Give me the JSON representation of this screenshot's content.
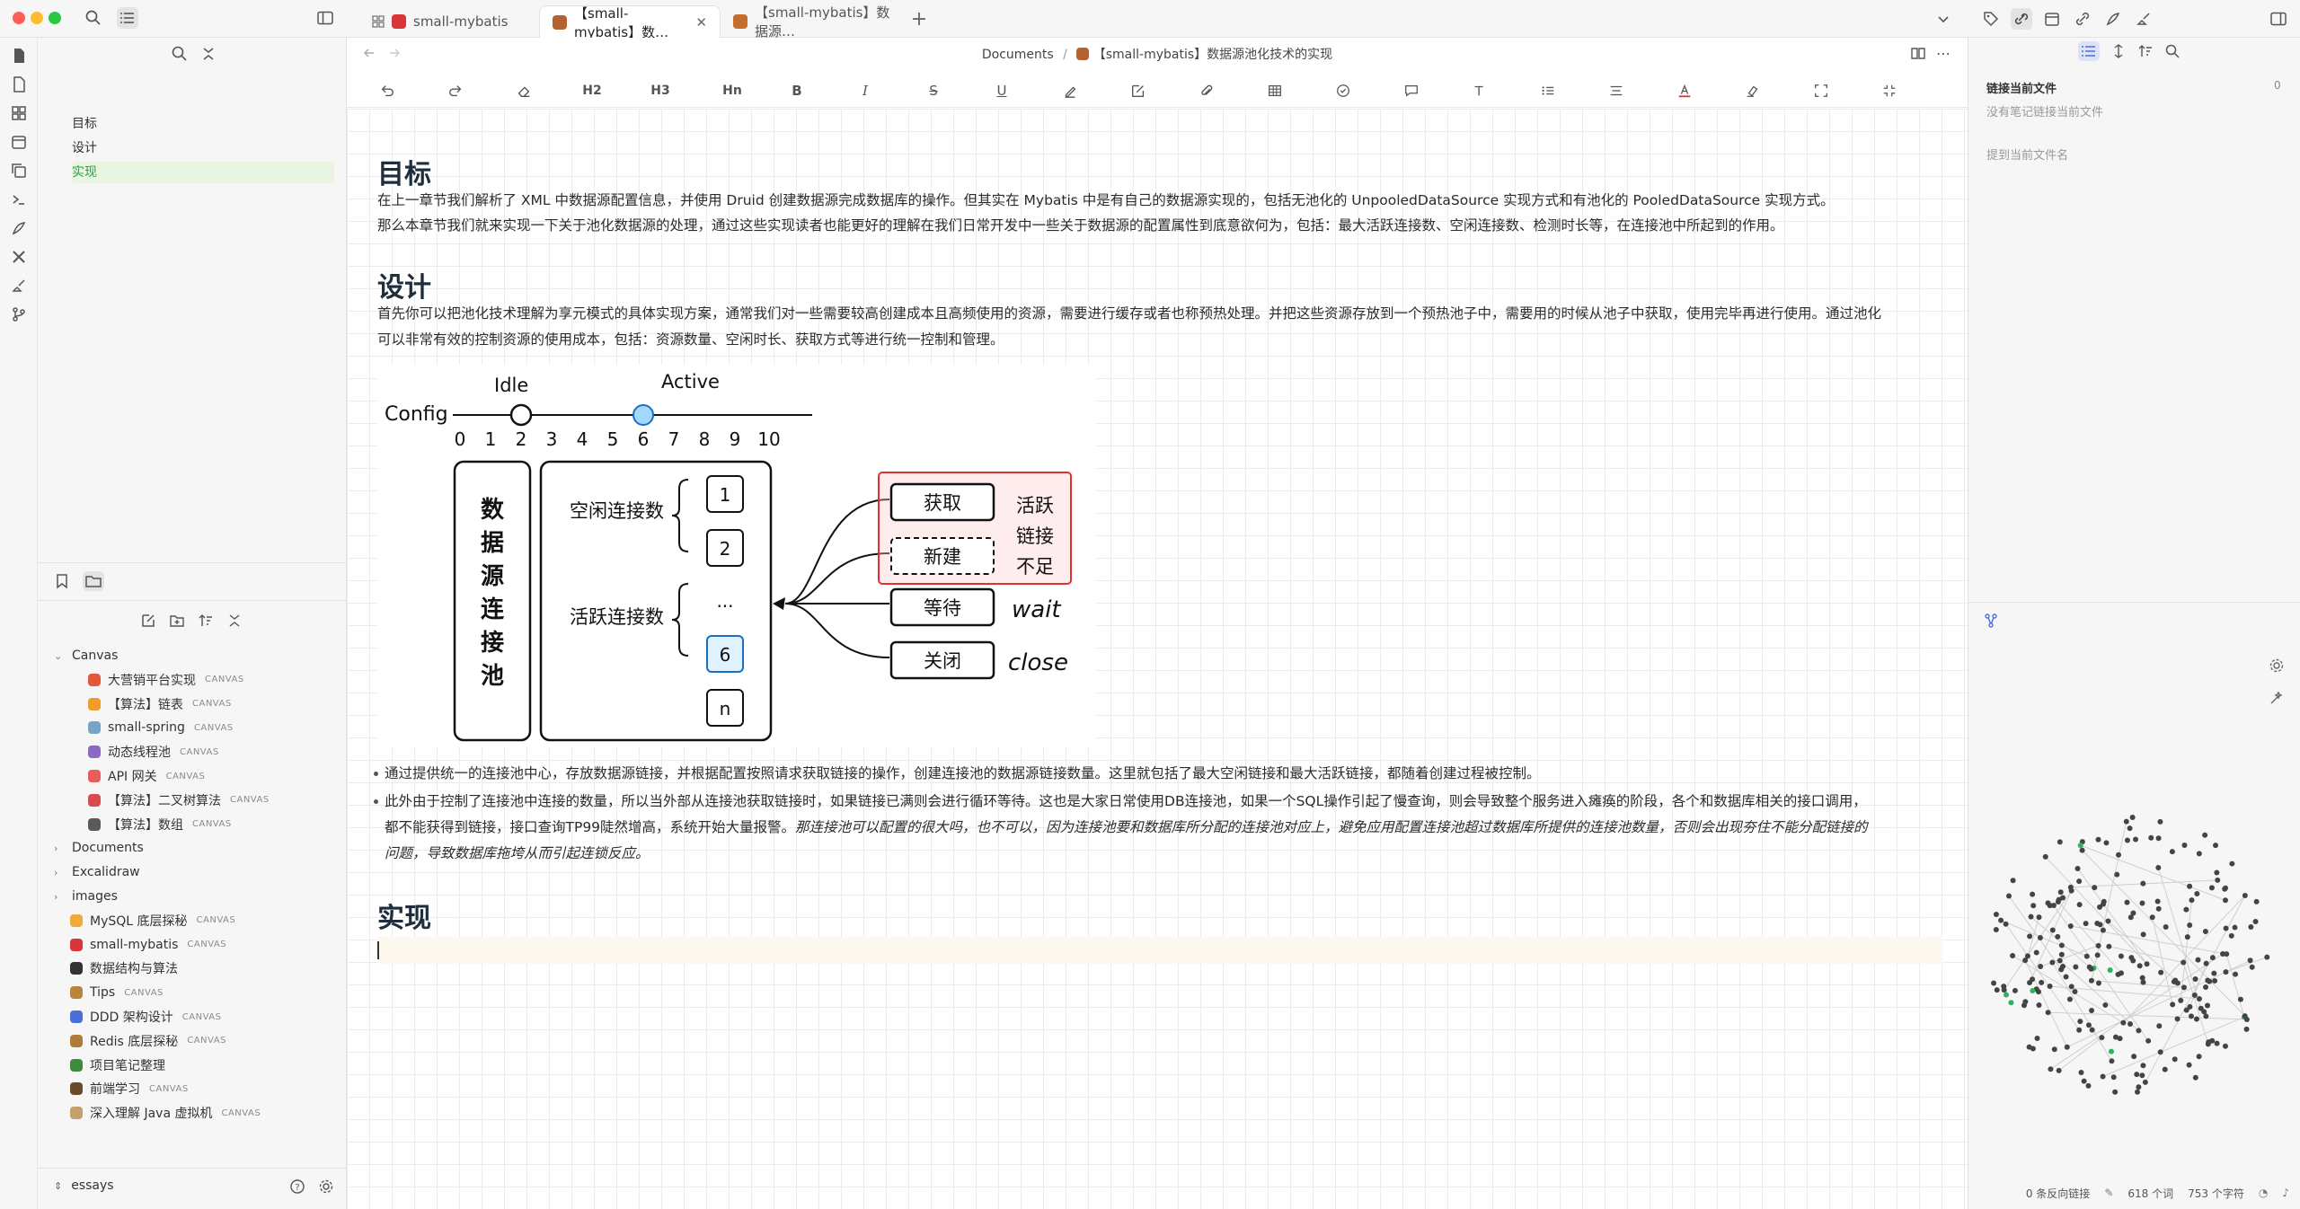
{
  "tabs": [
    {
      "label": "small-mybatis",
      "color": "#d9343a"
    },
    {
      "label": "【small-mybatis】数…",
      "color": "#b6622f"
    },
    {
      "label": "【small-mybatis】数据源…",
      "color": "#c46e2d"
    }
  ],
  "sidebar": {
    "outline": [
      {
        "label": "目标",
        "active": false
      },
      {
        "label": "设计",
        "active": false
      },
      {
        "label": "实现",
        "active": true
      }
    ],
    "tree": [
      {
        "label": "Canvas",
        "type": "folder-open",
        "depth": 0
      },
      {
        "label": "大营销平台实现",
        "badge": "CANVAS",
        "depth": 1,
        "color": "#e4573d"
      },
      {
        "label": "【算法】链表",
        "badge": "CANVAS",
        "depth": 1,
        "color": "#f29b2d"
      },
      {
        "label": "small-spring",
        "badge": "CANVAS",
        "depth": 1,
        "color": "#7aa3c9"
      },
      {
        "label": "动态线程池",
        "badge": "CANVAS",
        "depth": 1,
        "color": "#8a6bbf"
      },
      {
        "label": "API 网关",
        "badge": "CANVAS",
        "depth": 1,
        "color": "#e85d5d"
      },
      {
        "label": "【算法】二叉树算法",
        "badge": "CANVAS",
        "depth": 1,
        "color": "#d94b4b"
      },
      {
        "label": "【算法】数组",
        "badge": "CANVAS",
        "depth": 1,
        "color": "#5a5a5a"
      },
      {
        "label": "Documents",
        "type": "folder",
        "depth": 0
      },
      {
        "label": "Excalidraw",
        "type": "folder",
        "depth": 0
      },
      {
        "label": "images",
        "type": "folder",
        "depth": 0
      },
      {
        "label": "MySQL 底层探秘",
        "badge": "CANVAS",
        "depth": 0,
        "color": "#f2a93b"
      },
      {
        "label": "small-mybatis",
        "badge": "CANVAS",
        "depth": 0,
        "color": "#d9343a"
      },
      {
        "label": "数据结构与算法",
        "depth": 0,
        "color": "#333333"
      },
      {
        "label": "Tips",
        "badge": "CANVAS",
        "depth": 0,
        "color": "#b8853a"
      },
      {
        "label": "DDD 架构设计",
        "badge": "CANVAS",
        "depth": 0,
        "color": "#4a6fd9"
      },
      {
        "label": "Redis 底层探秘",
        "badge": "CANVAS",
        "depth": 0,
        "color": "#b07a3a"
      },
      {
        "label": "项目笔记整理",
        "depth": 0,
        "color": "#3f8a3f"
      },
      {
        "label": "前端学习",
        "badge": "CANVAS",
        "depth": 0,
        "color": "#6b4a2a"
      },
      {
        "label": "深入理解 Java 虚拟机",
        "badge": "CANVAS",
        "depth": 0,
        "color": "#c4a06b"
      }
    ],
    "vault": "essays"
  },
  "breadcrumb": {
    "folder": "Documents",
    "sep": "/",
    "file": "【small-mybatis】数据源池化技术的实现"
  },
  "toolbar": {
    "h2": "H2",
    "h3": "H3",
    "hn": "Hn",
    "bold": "B",
    "italic": "I",
    "strike": "S",
    "underline": "U"
  },
  "doc": {
    "h_goal": "目标",
    "goal_p1": "在上一章节我们解析了 XML 中数据源配置信息，并使用 Druid 创建数据源完成数据库的操作。但其实在 Mybatis 中是有自己的数据源实现的，包括无池化的 UnpooledDataSource 实现方式和有池化的 PooledDataSource 实现方式。",
    "goal_p2": "那么本章节我们就来实现一下关于池化数据源的处理，通过这些实现读者也能更好的理解在我们日常开发中一些关于数据源的配置属性到底意欲何为，包括：最大活跃连接数、空闲连接数、检测时长等，在连接池中所起到的作用。",
    "h_design": "设计",
    "design_p1": "首先你可以把池化技术理解为享元模式的具体实现方案，通常我们对一些需要较高创建成本且高频使用的资源，需要进行缓存或者也称预热处理。并把这些资源存放到一个预热池子中，需要用的时候从池子中获取，使用完毕再进行使用。通过池化",
    "design_p2": "可以非常有效的控制资源的使用成本，包括：资源数量、空闲时长、获取方式等进行统一控制和管理。",
    "bullet1": "通过提供统一的连接池中心，存放数据源链接，并根据配置按照请求获取链接的操作，创建连接池的数据源链接数量。这里就包括了最大空闲链接和最大活跃链接，都随着创建过程被控制。",
    "bullet2a": "此外由于控制了连接池中连接的数量，所以当外部从连接池获取链接时，如果链接已满则会进行循环等待。这也是大家日常使用DB连接池，如果一个SQL操作引起了慢查询，则会导致整个服务进入瘫痪的阶段，各个和数据库相关的接口调用，",
    "bullet2b": "都不能获得到链接，接口查询TP99陡然增高，系统开始大量报警。",
    "bullet2c": "那连接池可以配置的很大吗，也不可以，因为连接池要和数据库所分配的连接池对应上，避免应用配置连接池超过数据库所提供的连接池数量，否则会出现夯住不能分配链接的",
    "bullet2d": "问题，导致数据库拖垮从而引起连锁反应。",
    "h_impl": "实现"
  },
  "diagram": {
    "config": "Config",
    "idle": "Idle",
    "active": "Active",
    "ticks": [
      "0",
      "1",
      "2",
      "3",
      "4",
      "5",
      "6",
      "7",
      "8",
      "9",
      "10"
    ],
    "idle_value": 2,
    "active_value": 6,
    "pool_label": [
      "数",
      "据",
      "源",
      "连",
      "接",
      "池"
    ],
    "idle_conn": "空闲连接数",
    "active_conn": "活跃连接数",
    "slots": [
      "1",
      "2",
      "...",
      "6",
      "n"
    ],
    "ops": [
      "获取",
      "新建",
      "等待",
      "关闭"
    ],
    "insufficient": [
      "活跃",
      "链接",
      "不足"
    ],
    "wait": "wait",
    "close": "close"
  },
  "right": {
    "title": "链接当前文件",
    "count": "0",
    "empty": "没有笔记链接当前文件",
    "mentions": "提到当前文件名"
  },
  "status": {
    "backlinks": "0 条反向链接",
    "words": "618 个词",
    "chars": "753 个字符"
  }
}
